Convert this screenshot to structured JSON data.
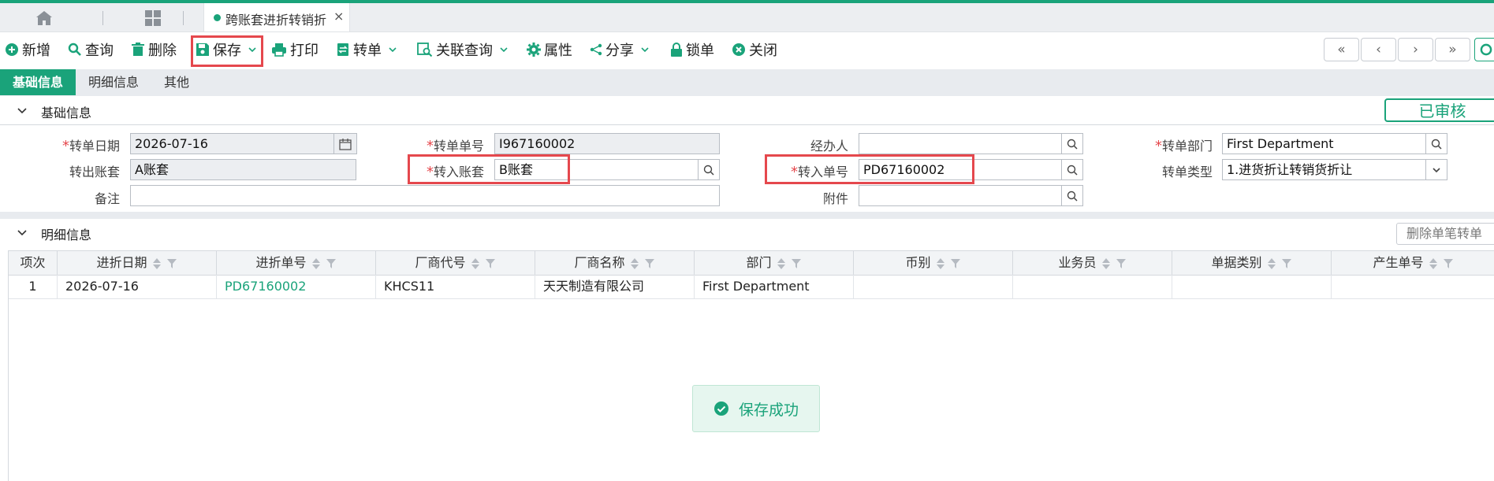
{
  "tabbar": {
    "doc_tab_label": "跨账套进折转销折",
    "close_glyph": "×"
  },
  "toolbar": {
    "new": "新增",
    "query": "查询",
    "delete": "删除",
    "save": "保存",
    "print": "打印",
    "transfer": "转单",
    "related_query": "关联查询",
    "properties": "属性",
    "share": "分享",
    "lock": "锁单",
    "close": "关闭"
  },
  "nav": {
    "first": "«",
    "prev": "‹",
    "next": "›",
    "last": "»"
  },
  "section_tabs": [
    "基础信息",
    "明细信息",
    "其他"
  ],
  "basic": {
    "title": "基础信息",
    "status": "已审核",
    "fields": {
      "transfer_date_label": "转单日期",
      "transfer_date": "2026-07-16",
      "transfer_no_label": "转单单号",
      "transfer_no": "I967160002",
      "handler_label": "经办人",
      "handler": "",
      "transfer_dept_label": "转单部门",
      "transfer_dept": "First Department",
      "out_account_label": "转出账套",
      "out_account": "A账套",
      "in_account_label": "转入账套",
      "in_account": "B账套",
      "in_no_label": "转入单号",
      "in_no": "PD67160002",
      "transfer_type_label": "转单类型",
      "transfer_type": "1.进货折让转销货折让",
      "remark_label": "备注",
      "remark": "",
      "attachment_label": "附件",
      "attachment": ""
    }
  },
  "detail": {
    "title": "明细信息",
    "delete_single_button": "删除单笔转单",
    "columns": [
      "项次",
      "进折日期",
      "进折单号",
      "厂商代号",
      "厂商名称",
      "部门",
      "币别",
      "业务员",
      "单据类别",
      "产生单号"
    ],
    "rows": [
      [
        "1",
        "2026-07-16",
        "PD67160002",
        "KHCS11",
        "天天制造有限公司",
        "First Department",
        "",
        "",
        "",
        ""
      ]
    ]
  },
  "toast": {
    "message": "保存成功"
  },
  "colors": {
    "accent": "#1aa37a",
    "highlight": "#e5484d",
    "required": "#e5484d"
  }
}
